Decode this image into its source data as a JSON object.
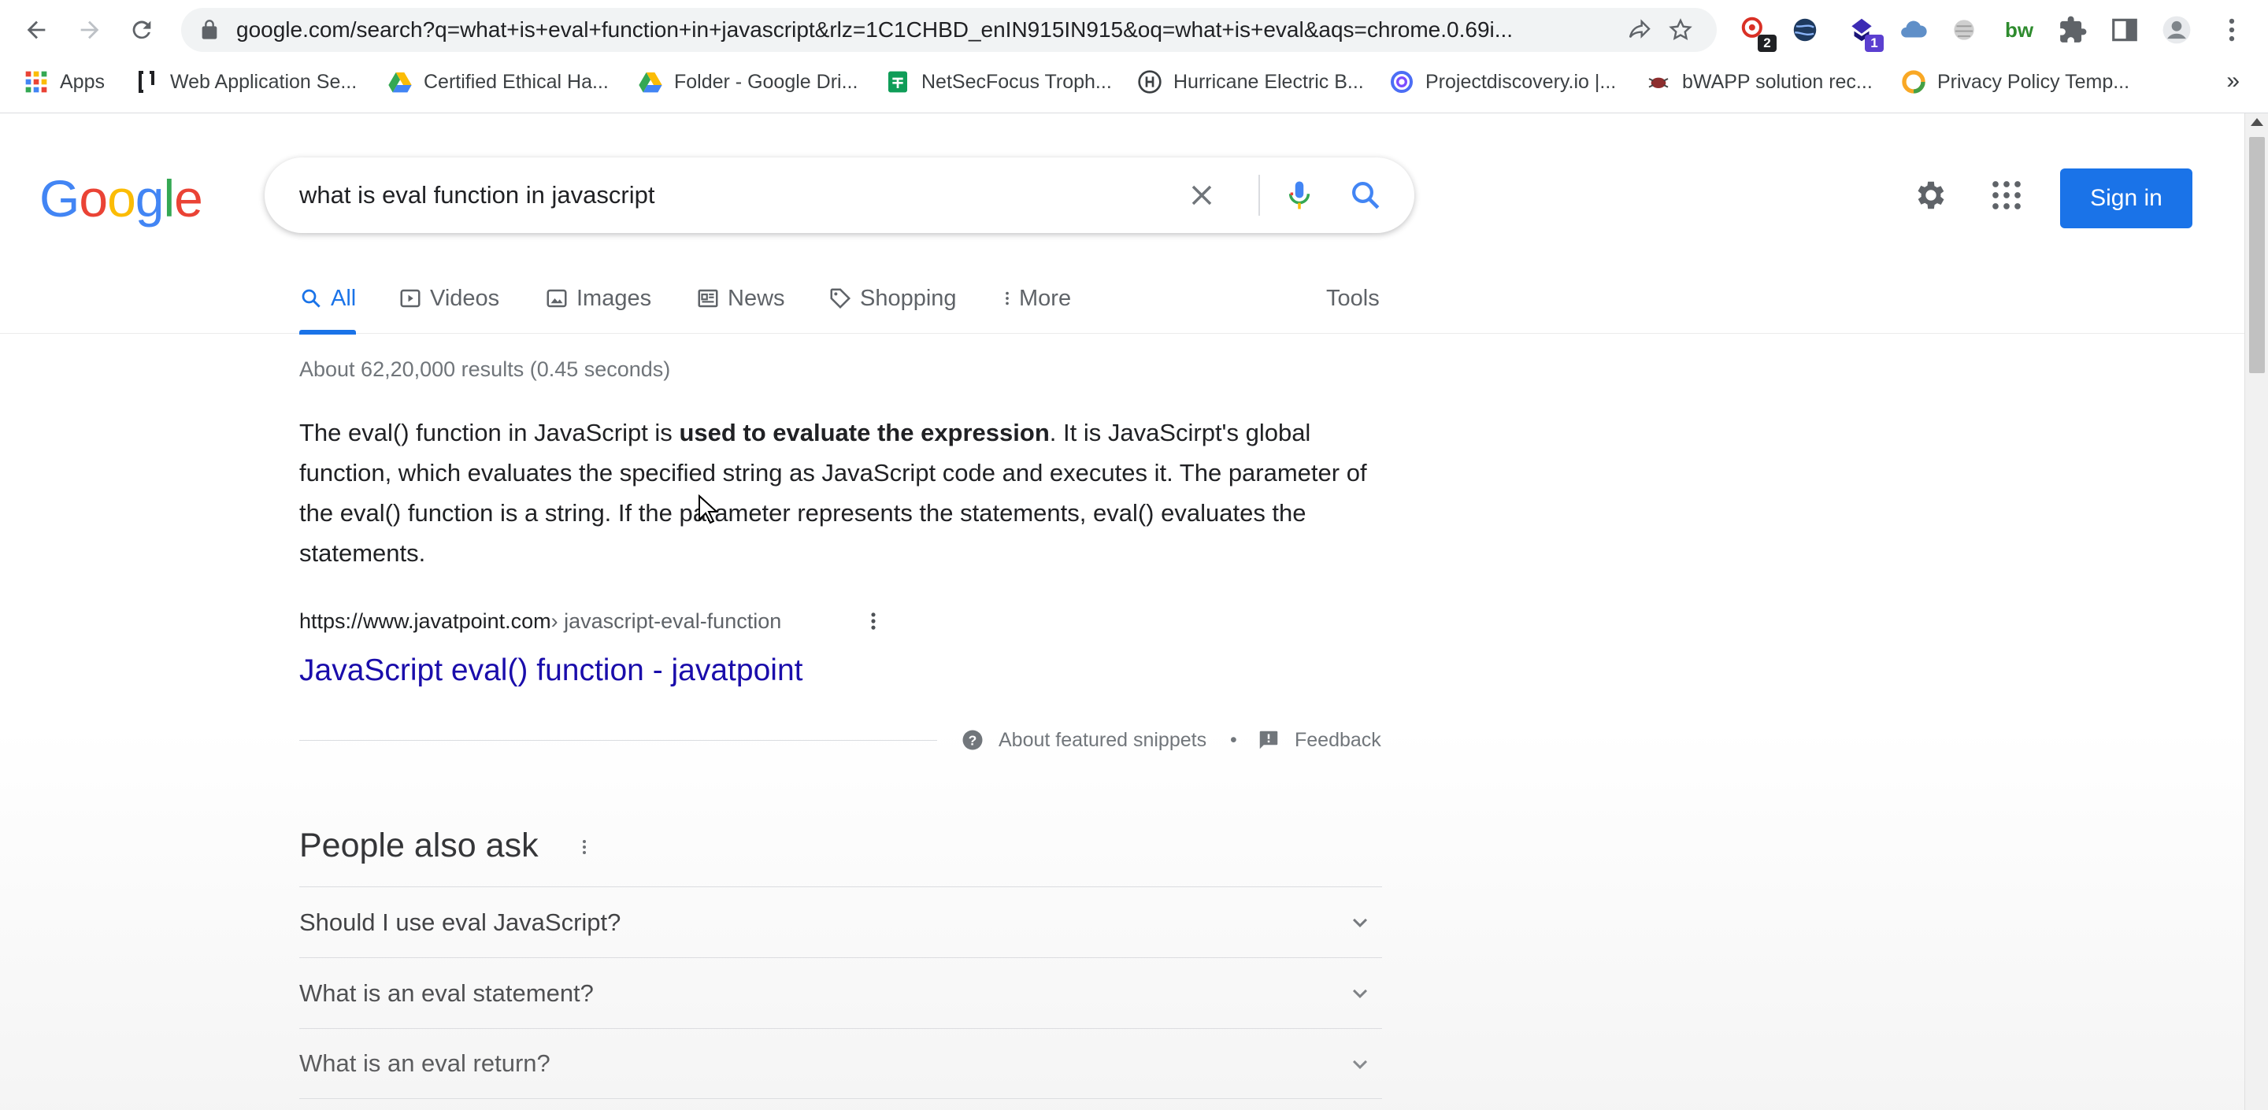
{
  "browser": {
    "url": "google.com/search?q=what+is+eval+function+in+javascript&rlz=1C1CHBD_enIN915IN915&oq=what+is+eval&aqs=chrome.0.69i...",
    "extensions": [
      {
        "name": "extension-1",
        "badge": "2",
        "badge_color": "#202124"
      },
      {
        "name": "extension-2",
        "badge": ""
      },
      {
        "name": "extension-3",
        "badge": "1",
        "badge_color": "#5b3fd0"
      },
      {
        "name": "cloud-extension",
        "badge": ""
      },
      {
        "name": "extension-5",
        "badge": ""
      },
      {
        "name": "bw-extension",
        "label": "bw"
      }
    ],
    "bookmarks": [
      "Apps",
      "Web Application Se...",
      "Certified Ethical Ha...",
      "Folder - Google Dri...",
      "NetSecFocus Troph...",
      "Hurricane Electric B...",
      "Projectdiscovery.io |...",
      "bWAPP solution rec...",
      "Privacy Policy Temp..."
    ],
    "bookmarks_overflow": "»"
  },
  "google": {
    "logo": [
      "G",
      "o",
      "o",
      "g",
      "l",
      "e"
    ],
    "logo_colors": [
      "#4285f4",
      "#ea4335",
      "#fbbc05",
      "#4285f4",
      "#34a853",
      "#ea4335"
    ],
    "query": "what is eval function in javascript",
    "sign_in": "Sign in",
    "tabs": [
      {
        "label": "All",
        "icon": "search-icon",
        "active": true
      },
      {
        "label": "Videos",
        "icon": "video-icon"
      },
      {
        "label": "Images",
        "icon": "image-icon"
      },
      {
        "label": "News",
        "icon": "news-icon"
      },
      {
        "label": "Shopping",
        "icon": "tag-icon"
      },
      {
        "label": "More",
        "icon": "more-vert-icon"
      }
    ],
    "tools": "Tools",
    "result_stats": "About 62,20,000 results (0.45 seconds)",
    "snippet": {
      "before": "The eval() function in JavaScript is ",
      "bold": "used to evaluate the expression",
      "after": ". It is JavaScirpt's global function, which evaluates the specified string as JavaScript code and executes it. The parameter of the eval() function is a string. If the parameter represents the statements, eval() evaluates the statements."
    },
    "cite": {
      "domain": "https://www.javatpoint.com",
      "path": " › javascript-eval-function"
    },
    "result_title": "JavaScript eval() function - javatpoint",
    "about_snippets": "About featured snippets",
    "bullet": "•",
    "feedback": "Feedback",
    "paa_title": "People also ask",
    "paa_questions": [
      "Should I use eval JavaScript?",
      "What is an eval statement?",
      "What is an eval return?"
    ]
  }
}
